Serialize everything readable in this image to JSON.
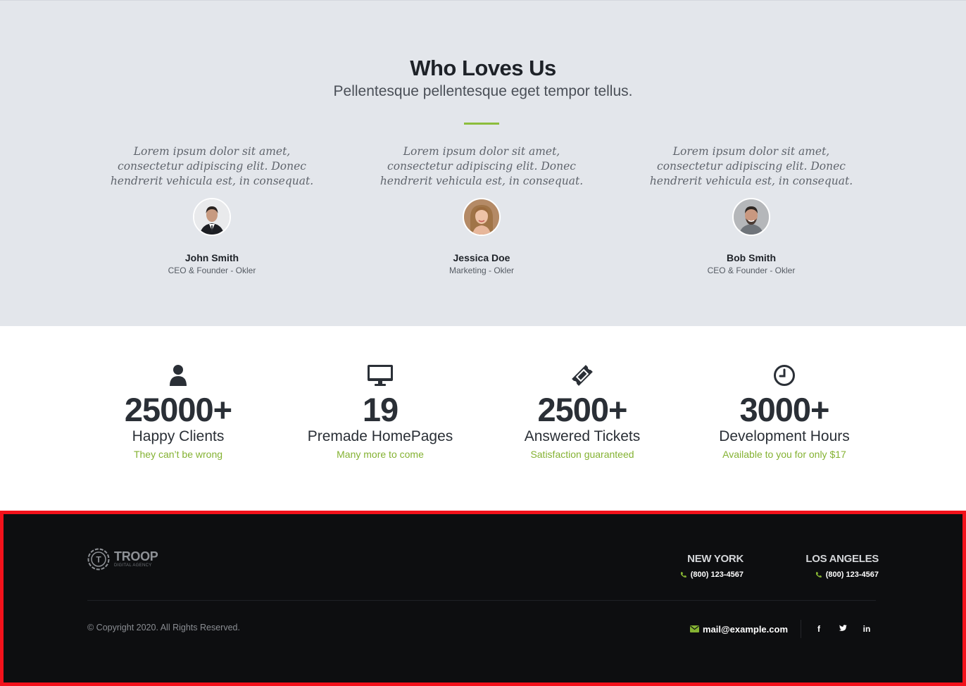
{
  "testimonials": {
    "title": "Who Loves Us",
    "subtitle": "Pellentesque pellentesque eget tempor tellus.",
    "accent_color": "#8cbd3c",
    "items": [
      {
        "quote": "Lorem ipsum dolor sit amet, consectetur adipiscing elit. Donec hendrerit vehicula est, in consequat.",
        "name": "John Smith",
        "role": "CEO & Founder - Okler"
      },
      {
        "quote": "Lorem ipsum dolor sit amet, consectetur adipiscing elit. Donec hendrerit vehicula est, in consequat.",
        "name": "Jessica Doe",
        "role": "Marketing - Okler"
      },
      {
        "quote": "Lorem ipsum dolor sit amet, consectetur adipiscing elit. Donec hendrerit vehicula est, in consequat.",
        "name": "Bob Smith",
        "role": "CEO & Founder - Okler"
      }
    ]
  },
  "counters": {
    "items": [
      {
        "icon": "user-icon",
        "number": "25000+",
        "label": "Happy Clients",
        "sub": "They can’t be wrong"
      },
      {
        "icon": "desktop-icon",
        "number": "19",
        "label": "Premade HomePages",
        "sub": "Many more to come"
      },
      {
        "icon": "ticket-icon",
        "number": "2500+",
        "label": "Answered Tickets",
        "sub": "Satisfaction guaranteed"
      },
      {
        "icon": "clock-icon",
        "number": "3000+",
        "label": "Development Hours",
        "sub": "Available to you for only $17"
      }
    ],
    "accent_color": "#84b232"
  },
  "footer": {
    "logo": {
      "name": "TROOP",
      "tagline": "DIGITAL AGENCY",
      "icon_letter": "T"
    },
    "offices": [
      {
        "city": "NEW YORK",
        "phone": "(800) 123-4567"
      },
      {
        "city": "LOS ANGELES",
        "phone": "(800) 123-4567"
      }
    ],
    "copyright": "© Copyright 2020. All Rights Reserved.",
    "email": "mail@example.com",
    "social": [
      {
        "icon": "facebook-icon",
        "label": "f"
      },
      {
        "icon": "twitter-icon",
        "label": "🐦"
      },
      {
        "icon": "linkedin-icon",
        "label": "in"
      }
    ],
    "highlight_border_color": "#f2121b"
  }
}
